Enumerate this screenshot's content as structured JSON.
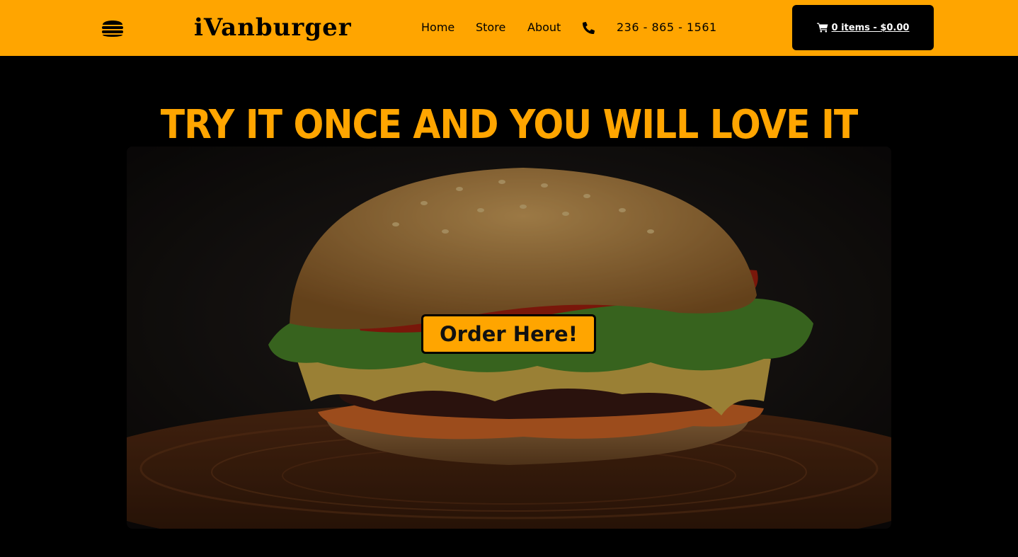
{
  "navbar": {
    "brand": "iVanburger",
    "links": [
      "Home",
      "Store",
      "About"
    ],
    "phone": "236 - 865 - 1561",
    "cart": "0 items - $0.00",
    "background_color": "#FFA500",
    "icons": [
      "burger-logo-icon",
      "phone-icon",
      "cart-icon"
    ]
  },
  "hero": {
    "title": "Try it once and you will love it",
    "image": "burger-photo",
    "order_button": "Order Here!",
    "accent_color": "#FFA500"
  }
}
